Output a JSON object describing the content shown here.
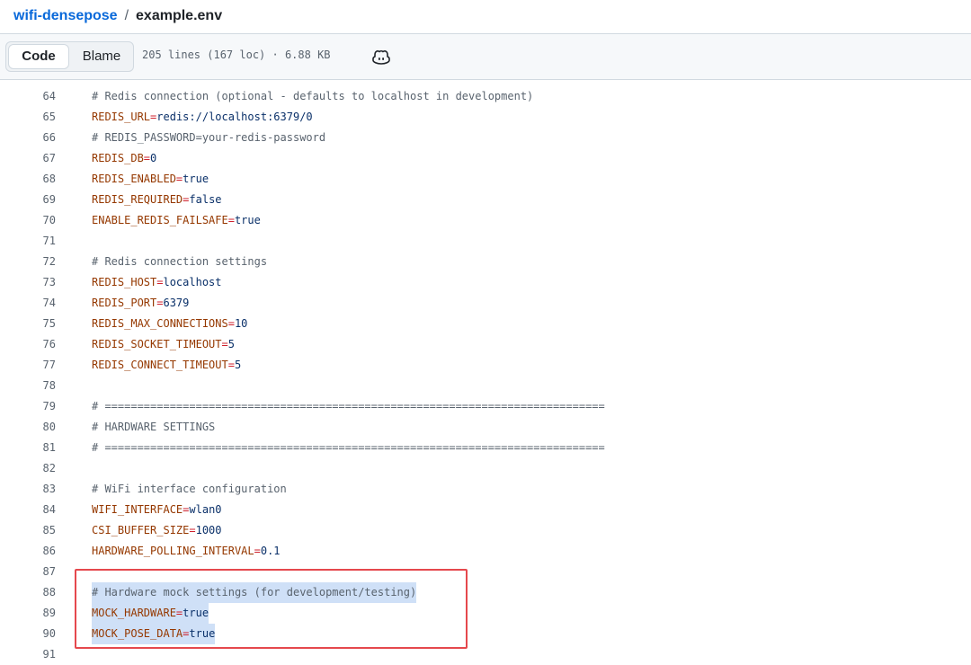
{
  "breadcrumb": {
    "repo": "wifi-densepose",
    "separator": "/",
    "file": "example.env"
  },
  "toolbar": {
    "code_label": "Code",
    "blame_label": "Blame",
    "file_info": "205 lines (167 loc) · 6.88 KB",
    "copilot_icon": "copilot-icon"
  },
  "lines": [
    {
      "n": "64",
      "parts": [
        {
          "t": "# Redis connection (optional - defaults to localhost in development)",
          "c": "com"
        }
      ]
    },
    {
      "n": "65",
      "parts": [
        {
          "t": "REDIS_URL",
          "c": "key"
        },
        {
          "t": "=",
          "c": "eq"
        },
        {
          "t": "redis://localhost:6379/0",
          "c": "val"
        }
      ]
    },
    {
      "n": "66",
      "parts": [
        {
          "t": "# REDIS_PASSWORD=your-redis-password",
          "c": "com"
        }
      ]
    },
    {
      "n": "67",
      "parts": [
        {
          "t": "REDIS_DB",
          "c": "key"
        },
        {
          "t": "=",
          "c": "eq"
        },
        {
          "t": "0",
          "c": "val"
        }
      ]
    },
    {
      "n": "68",
      "parts": [
        {
          "t": "REDIS_ENABLED",
          "c": "key"
        },
        {
          "t": "=",
          "c": "eq"
        },
        {
          "t": "true",
          "c": "val"
        }
      ]
    },
    {
      "n": "69",
      "parts": [
        {
          "t": "REDIS_REQUIRED",
          "c": "key"
        },
        {
          "t": "=",
          "c": "eq"
        },
        {
          "t": "false",
          "c": "val"
        }
      ]
    },
    {
      "n": "70",
      "parts": [
        {
          "t": "ENABLE_REDIS_FAILSAFE",
          "c": "key"
        },
        {
          "t": "=",
          "c": "eq"
        },
        {
          "t": "true",
          "c": "val"
        }
      ]
    },
    {
      "n": "71",
      "parts": []
    },
    {
      "n": "72",
      "parts": [
        {
          "t": "# Redis connection settings",
          "c": "com"
        }
      ]
    },
    {
      "n": "73",
      "parts": [
        {
          "t": "REDIS_HOST",
          "c": "key"
        },
        {
          "t": "=",
          "c": "eq"
        },
        {
          "t": "localhost",
          "c": "val"
        }
      ]
    },
    {
      "n": "74",
      "parts": [
        {
          "t": "REDIS_PORT",
          "c": "key"
        },
        {
          "t": "=",
          "c": "eq"
        },
        {
          "t": "6379",
          "c": "val"
        }
      ]
    },
    {
      "n": "75",
      "parts": [
        {
          "t": "REDIS_MAX_CONNECTIONS",
          "c": "key"
        },
        {
          "t": "=",
          "c": "eq"
        },
        {
          "t": "10",
          "c": "val"
        }
      ]
    },
    {
      "n": "76",
      "parts": [
        {
          "t": "REDIS_SOCKET_TIMEOUT",
          "c": "key"
        },
        {
          "t": "=",
          "c": "eq"
        },
        {
          "t": "5",
          "c": "val"
        }
      ]
    },
    {
      "n": "77",
      "parts": [
        {
          "t": "REDIS_CONNECT_TIMEOUT",
          "c": "key"
        },
        {
          "t": "=",
          "c": "eq"
        },
        {
          "t": "5",
          "c": "val"
        }
      ]
    },
    {
      "n": "78",
      "parts": []
    },
    {
      "n": "79",
      "parts": [
        {
          "t": "# =============================================================================",
          "c": "com"
        }
      ]
    },
    {
      "n": "80",
      "parts": [
        {
          "t": "# HARDWARE SETTINGS",
          "c": "com"
        }
      ]
    },
    {
      "n": "81",
      "parts": [
        {
          "t": "# =============================================================================",
          "c": "com"
        }
      ]
    },
    {
      "n": "82",
      "parts": []
    },
    {
      "n": "83",
      "parts": [
        {
          "t": "# WiFi interface configuration",
          "c": "com"
        }
      ]
    },
    {
      "n": "84",
      "parts": [
        {
          "t": "WIFI_INTERFACE",
          "c": "key"
        },
        {
          "t": "=",
          "c": "eq"
        },
        {
          "t": "wlan0",
          "c": "val"
        }
      ]
    },
    {
      "n": "85",
      "parts": [
        {
          "t": "CSI_BUFFER_SIZE",
          "c": "key"
        },
        {
          "t": "=",
          "c": "eq"
        },
        {
          "t": "1000",
          "c": "val"
        }
      ]
    },
    {
      "n": "86",
      "parts": [
        {
          "t": "HARDWARE_POLLING_INTERVAL",
          "c": "key"
        },
        {
          "t": "=",
          "c": "eq"
        },
        {
          "t": "0.1",
          "c": "val"
        }
      ]
    },
    {
      "n": "87",
      "parts": []
    },
    {
      "n": "88",
      "hl": true,
      "parts": [
        {
          "t": "# Hardware mock settings (for development/testing)",
          "c": "com"
        }
      ]
    },
    {
      "n": "89",
      "hl": true,
      "parts": [
        {
          "t": "MOCK_HARDWARE",
          "c": "key"
        },
        {
          "t": "=",
          "c": "eq"
        },
        {
          "t": "true",
          "c": "val"
        }
      ]
    },
    {
      "n": "90",
      "hl": true,
      "parts": [
        {
          "t": "MOCK_POSE_DATA",
          "c": "key"
        },
        {
          "t": "=",
          "c": "eq"
        },
        {
          "t": "true",
          "c": "val"
        }
      ]
    },
    {
      "n": "91",
      "parts": []
    }
  ],
  "colors": {
    "link": "#0969da",
    "comment": "#59636e",
    "key": "#953800",
    "value": "#0a3069",
    "selection": "#cfe0f7",
    "annotation_box": "#e5484d"
  }
}
